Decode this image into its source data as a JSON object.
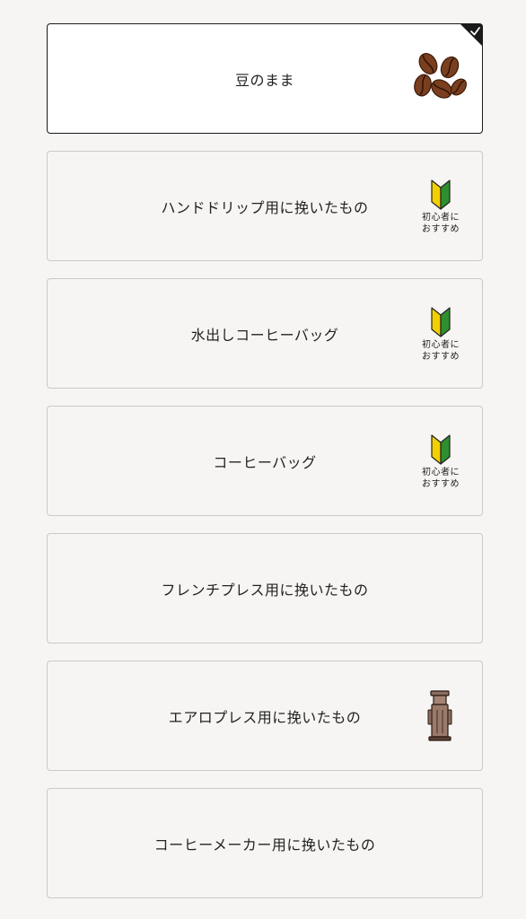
{
  "options": [
    {
      "label": "豆のまま",
      "selected": true,
      "icon": "coffee-beans-icon"
    },
    {
      "label": "ハンドドリップ用に挽いたもの",
      "selected": false,
      "icon": "beginner-mark-icon",
      "badge": [
        "初心者に",
        "おすすめ"
      ]
    },
    {
      "label": "水出しコーヒーバッグ",
      "selected": false,
      "icon": "beginner-mark-icon",
      "badge": [
        "初心者に",
        "おすすめ"
      ]
    },
    {
      "label": "コーヒーバッグ",
      "selected": false,
      "icon": "beginner-mark-icon",
      "badge": [
        "初心者に",
        "おすすめ"
      ]
    },
    {
      "label": "フレンチプレス用に挽いたもの",
      "selected": false,
      "icon": null
    },
    {
      "label": "エアロプレス用に挽いたもの",
      "selected": false,
      "icon": "aeropress-icon"
    },
    {
      "label": "コーヒーメーカー用に挽いたもの",
      "selected": false,
      "icon": null
    }
  ],
  "colors": {
    "selected_border": "#1a1a1a",
    "default_border": "#c9c9c9",
    "background": "#f6f5f3",
    "bean_brown": "#7a3f1f",
    "mark_yellow": "#f2d000",
    "mark_green": "#2f8f2f"
  }
}
